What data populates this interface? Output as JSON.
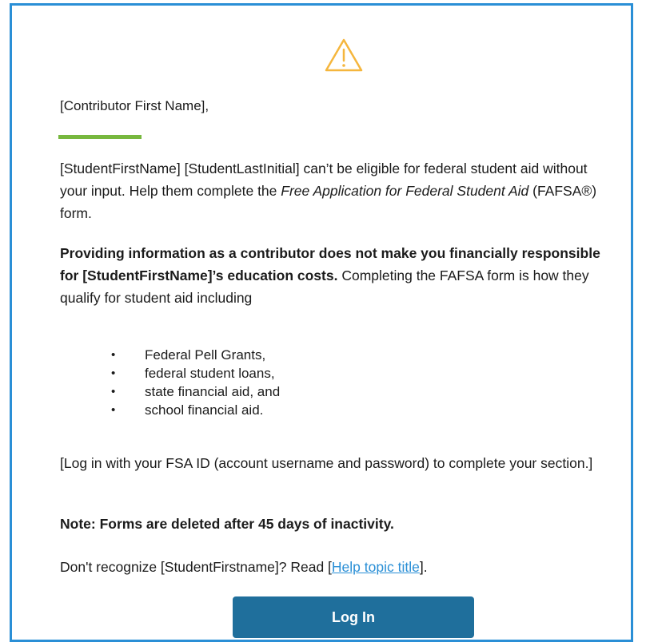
{
  "email": {
    "greeting": "[Contributor First Name],",
    "paragraph1": {
      "text_start": "[StudentFirstName] [StudentLastInitial] can’t be eligible for federal student aid without your input. Help them complete the ",
      "italic": "Free Application for Federal Student Aid",
      "text_end": " (FAFSA®) form."
    },
    "paragraph2": {
      "bold": "Providing information as a contributor does not make you financially responsible for [StudentFirstName]’s education costs.",
      "text": " Completing the FAFSA form is how they qualify for student aid including"
    },
    "aid_types": [
      "Federal Pell Grants,",
      "federal student loans,",
      "state financial aid, and",
      "school financial aid."
    ],
    "login_instruction": "[Log in with your FSA ID (account username and password) to complete your section.]",
    "note": "Note: Forms are deleted after 45 days of inactivity.",
    "recognize": {
      "text_start": "Don't recognize [StudentFirstname]? Read [",
      "link": "Help topic title",
      "text_end": "]."
    },
    "login_button": "Log In"
  },
  "colors": {
    "frame_border": "#2a8fd6",
    "warning_icon": "#f5b63d",
    "divider": "#77b83e",
    "button": "#1f6f9c",
    "link": "#2a8fd6"
  },
  "icons": {
    "header": "warning-icon"
  }
}
